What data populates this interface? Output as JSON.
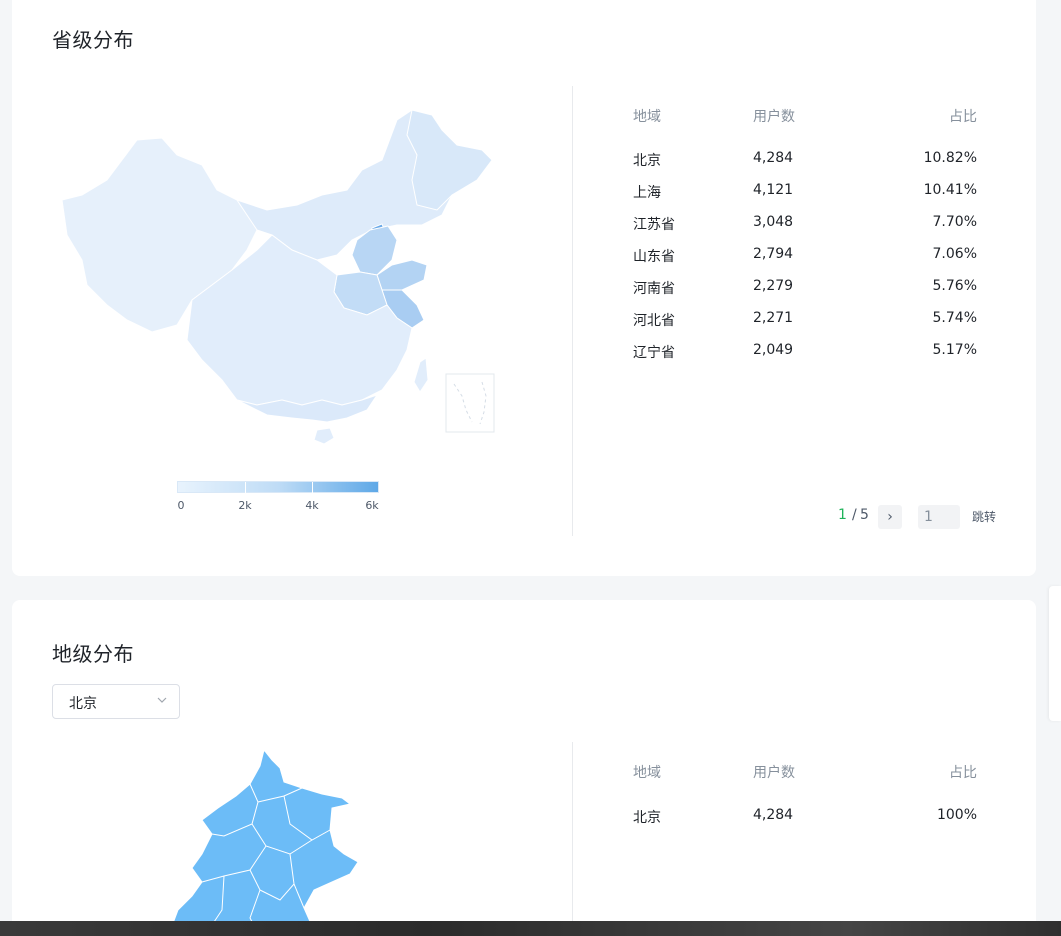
{
  "province_section": {
    "title": "省级分布",
    "table": {
      "headers": [
        "地域",
        "用户数",
        "占比"
      ],
      "rows": [
        {
          "region": "北京",
          "users": "4,284",
          "share": "10.82%"
        },
        {
          "region": "上海",
          "users": "4,121",
          "share": "10.41%"
        },
        {
          "region": "江苏省",
          "users": "3,048",
          "share": "7.70%"
        },
        {
          "region": "山东省",
          "users": "2,794",
          "share": "7.06%"
        },
        {
          "region": "河南省",
          "users": "2,279",
          "share": "5.76%"
        },
        {
          "region": "河北省",
          "users": "2,271",
          "share": "5.74%"
        },
        {
          "region": "辽宁省",
          "users": "2,049",
          "share": "5.17%"
        }
      ]
    },
    "legend": {
      "ticks": [
        "0",
        "2k",
        "4k",
        "6k"
      ]
    },
    "pagination": {
      "current": "1",
      "separator": "/",
      "total": "5",
      "next_icon": "›",
      "jump_value": "1",
      "jump_label": "跳转"
    }
  },
  "city_section": {
    "title": "地级分布",
    "select": {
      "value": "北京",
      "icon": "chevron-down-icon"
    },
    "table": {
      "headers": [
        "地域",
        "用户数",
        "占比"
      ],
      "rows": [
        {
          "region": "北京",
          "users": "4,284",
          "share": "100%"
        }
      ]
    }
  },
  "colors": {
    "map_low": "#e3eefb",
    "map_mid": "#bcd8f5",
    "map_high": "#6aa9e8",
    "city_map": "#6cbcf7",
    "pager_current": "#1fb35a"
  }
}
